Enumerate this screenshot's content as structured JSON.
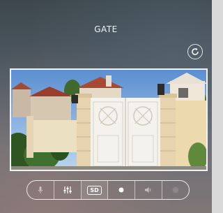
{
  "header": {
    "title": "GATE"
  },
  "toolbar": {
    "items": [
      {
        "name": "microphone",
        "icon": "microphone-icon"
      },
      {
        "name": "settings",
        "icon": "equalizer-icon"
      },
      {
        "name": "sd",
        "label": "SD",
        "icon": "sd-badge"
      },
      {
        "name": "record",
        "icon": "dot-icon"
      },
      {
        "name": "volume",
        "icon": "speaker-icon"
      },
      {
        "name": "end",
        "icon": "disabled-dot-icon"
      }
    ]
  },
  "colors": {
    "background_top": "#3d474d",
    "background_bottom": "#7f7677",
    "accent": "#ffffff"
  }
}
